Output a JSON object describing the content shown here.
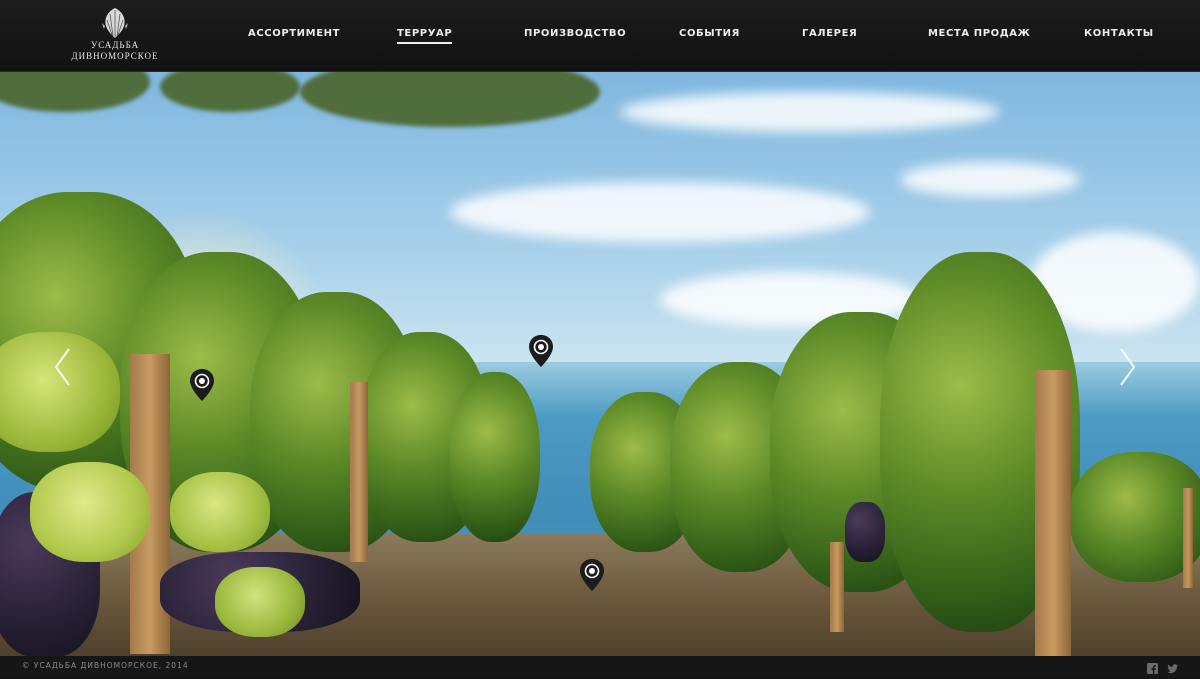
{
  "brand": {
    "line1": "УСАДЬБА",
    "line2": "ДИВНОМОРСКОЕ",
    "icon": "seashell-icon"
  },
  "nav": {
    "items": [
      {
        "label": "АССОРТИМЕНТ",
        "active": false
      },
      {
        "label": "ТЕРРУАР",
        "active": true
      },
      {
        "label": "ПРОИЗВОДСТВО",
        "active": false
      },
      {
        "label": "СОБЫТИЯ",
        "active": false
      },
      {
        "label": "ГАЛЕРЕЯ",
        "active": false
      },
      {
        "label": "МЕСТА ПРОДАЖ",
        "active": false
      },
      {
        "label": "КОНТАКТЫ",
        "active": false
      }
    ]
  },
  "hero": {
    "prev_icon": "chevron-left-icon",
    "next_icon": "chevron-right-icon",
    "pin_icon": "map-pin-icon"
  },
  "footer": {
    "copyright": "© УСАДЬБА ДИВНОМОРСКОЕ, 2014",
    "social": [
      "facebook-icon",
      "twitter-icon"
    ]
  },
  "colors": {
    "header_bg": "#161616",
    "nav_text": "#ededed",
    "footer_text": "#8a8a8a"
  }
}
